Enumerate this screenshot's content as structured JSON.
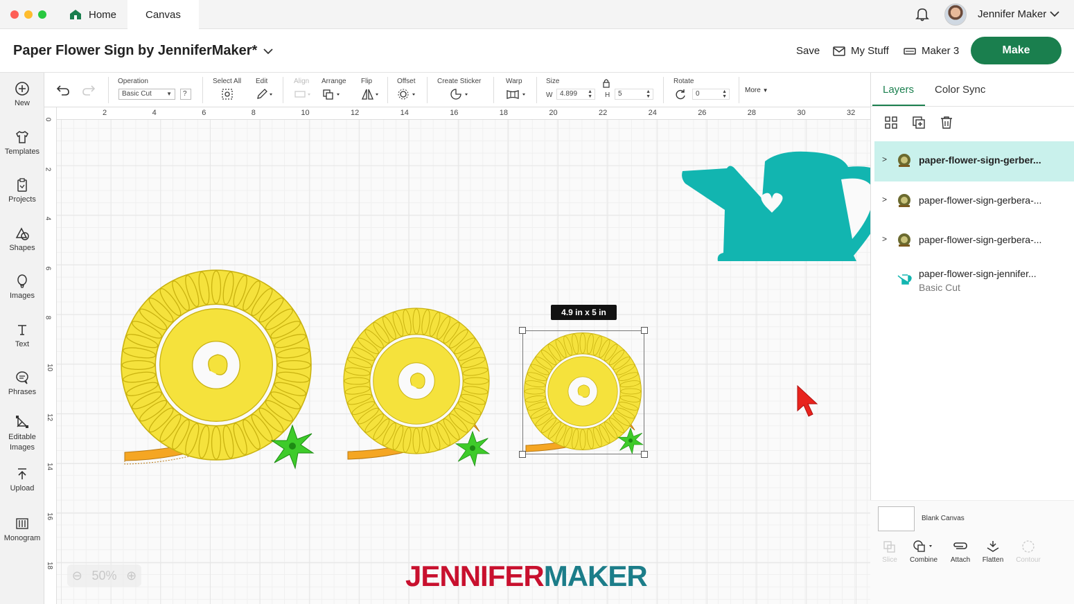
{
  "window": {
    "tabs": [
      {
        "label": "Home"
      },
      {
        "label": "Canvas"
      }
    ],
    "user": {
      "name": "Jennifer Maker"
    }
  },
  "header": {
    "project_title": "Paper Flower Sign by JenniferMaker*",
    "save_label": "Save",
    "my_stuff_label": "My Stuff",
    "machine_label": "Maker 3",
    "make_label": "Make"
  },
  "sidebar": {
    "items": [
      {
        "label": "New"
      },
      {
        "label": "Templates"
      },
      {
        "label": "Projects"
      },
      {
        "label": "Shapes"
      },
      {
        "label": "Images"
      },
      {
        "label": "Text"
      },
      {
        "label": "Phrases"
      },
      {
        "label": "Editable Images"
      },
      {
        "label": "Upload"
      },
      {
        "label": "Monogram"
      }
    ]
  },
  "toolbar": {
    "operation_label": "Operation",
    "operation_value": "Basic Cut",
    "help_glyph": "?",
    "select_all_label": "Select All",
    "edit_label": "Edit",
    "align_label": "Align",
    "arrange_label": "Arrange",
    "flip_label": "Flip",
    "offset_label": "Offset",
    "create_sticker_label": "Create Sticker",
    "warp_label": "Warp",
    "size_label": "Size",
    "width_prefix": "W",
    "width_value": "4.899",
    "height_prefix": "H",
    "height_value": "5",
    "rotate_label": "Rotate",
    "rotate_value": "0",
    "more_label": "More"
  },
  "canvas": {
    "ruler_x": [
      "2",
      "4",
      "6",
      "8",
      "10",
      "12",
      "14",
      "16",
      "18",
      "20",
      "22",
      "24",
      "26",
      "28",
      "30",
      "32"
    ],
    "ruler_y": [
      "0",
      "2",
      "4",
      "6",
      "8",
      "10",
      "12",
      "14",
      "16",
      "18"
    ],
    "selection_dimensions": "4.9  in x 5  in",
    "zoom_level": "50%",
    "watermark_part1": "JENNIFER",
    "watermark_part2": "MAKER"
  },
  "panel": {
    "tabs": [
      {
        "label": "Layers"
      },
      {
        "label": "Color Sync"
      }
    ],
    "layers": [
      {
        "name": "paper-flower-sign-gerber...",
        "selected": true
      },
      {
        "name": "paper-flower-sign-gerbera-...",
        "selected": false
      },
      {
        "name": "paper-flower-sign-gerbera-...",
        "selected": false
      },
      {
        "name": "paper-flower-sign-jennifer...",
        "sub": "Basic Cut",
        "selected": false
      }
    ],
    "blank_canvas_label": "Blank Canvas",
    "bottom_actions": [
      {
        "label": "Slice",
        "enabled": false
      },
      {
        "label": "Combine",
        "enabled": true
      },
      {
        "label": "Attach",
        "enabled": true
      },
      {
        "label": "Flatten",
        "enabled": true
      },
      {
        "label": "Contour",
        "enabled": false
      }
    ]
  },
  "colors": {
    "accent": "#1a7f4e",
    "flower_yellow": "#f5e23c",
    "flower_orange": "#f5a623",
    "leaf_green": "#3ecb2a",
    "watering_can": "#12b5b0",
    "watermark_red": "#c8102e",
    "watermark_teal": "#1c7d89"
  }
}
